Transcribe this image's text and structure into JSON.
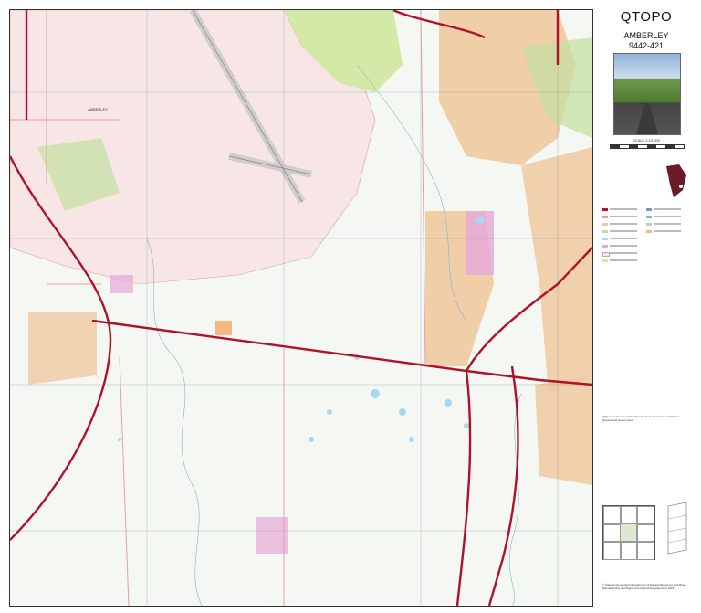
{
  "header": {
    "series": "QTOPO",
    "sheet_name": "AMBERLEY",
    "sheet_number": "9442-421"
  },
  "scale": {
    "label": "SCALE 1:10,000"
  },
  "map": {
    "place_labels": [
      "AMBERLEY"
    ],
    "colors": {
      "background": "#f5f7f2",
      "airbase": "#f8e6e6",
      "urban": "#f0c9a0",
      "vegetation": "#d4e8a8",
      "green_area": "#c3dfa0",
      "water": "#a8d8f0",
      "motorway": "#b0102a",
      "road": "#e6a0a0",
      "grid": "#7a9ab5",
      "pink_zone": "#e6a8d8"
    }
  },
  "panel": {
    "disclaimer_heading": "QTopo has been compiled from the best information available to Queensland Government.",
    "copyright": "© State of Queensland (Department of Natural Resources and Mines, Manufacturing and Regional and Rural Development) 2025"
  }
}
